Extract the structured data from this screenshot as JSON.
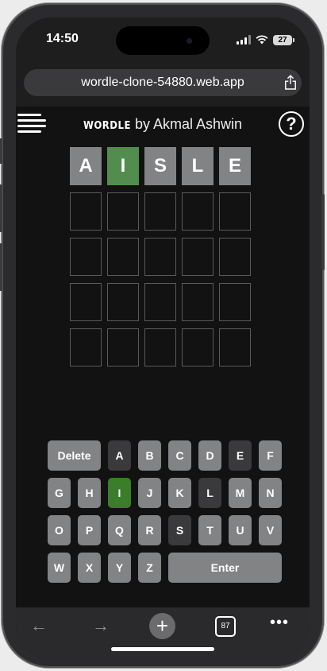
{
  "status_bar": {
    "time": "14:50",
    "battery": "27"
  },
  "browser": {
    "url": "wordle-clone-54880.web.app",
    "tab_count": "87"
  },
  "header": {
    "brand": "WORDLE",
    "subtitle": " by Akmal Ashwin",
    "help": "?"
  },
  "colors": {
    "correct": "#538d4e",
    "present": "#b59f3b",
    "absent": "#3a3a3c",
    "tile_revealed": "#818384",
    "correct_key": "#3a7d2a",
    "key": "#818384"
  },
  "board": {
    "rows": [
      [
        "A",
        "I",
        "S",
        "L",
        "E"
      ],
      [
        "",
        "",
        "",
        "",
        ""
      ],
      [
        "",
        "",
        "",
        "",
        ""
      ],
      [
        "",
        "",
        "",
        "",
        ""
      ],
      [
        "",
        "",
        "",
        "",
        ""
      ]
    ],
    "row1_states": [
      "gray",
      "correct",
      "gray",
      "gray",
      "gray"
    ]
  },
  "keyboard": {
    "row1": [
      "Delete",
      "A",
      "B",
      "C",
      "D",
      "E",
      "F"
    ],
    "row2": [
      "G",
      "H",
      "I",
      "J",
      "K",
      "L",
      "M",
      "N"
    ],
    "row3": [
      "O",
      "P",
      "Q",
      "R",
      "S",
      "T",
      "U",
      "V"
    ],
    "row4": [
      "W",
      "X",
      "Y",
      "Z",
      "Enter"
    ],
    "states": {
      "A": "absent",
      "E": "absent",
      "I": "correct",
      "L": "absent",
      "S": "absent"
    }
  },
  "toolbar": {
    "back": "←",
    "forward": "→",
    "new_tab": "+",
    "more": "•••"
  }
}
